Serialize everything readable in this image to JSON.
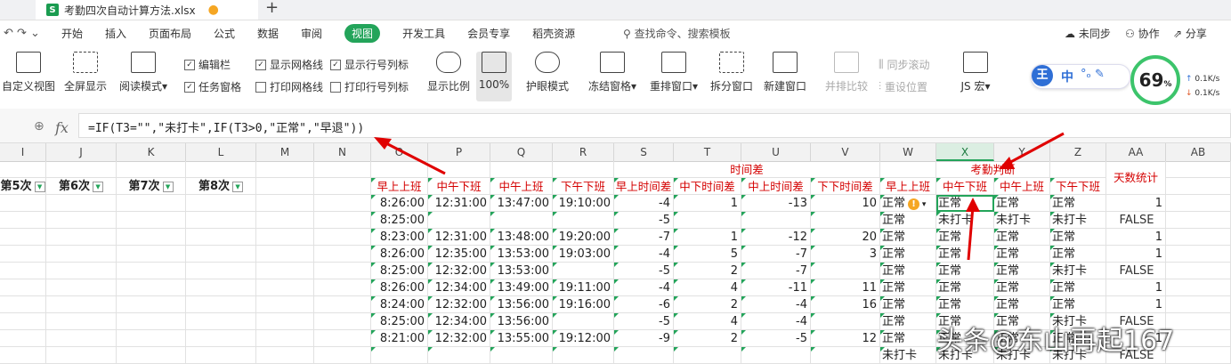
{
  "app": {
    "file_tab": "考勤四次自动计算方法.xlsx",
    "menus": [
      "开始",
      "插入",
      "页面布局",
      "公式",
      "数据",
      "审阅",
      "视图",
      "开发工具",
      "会员专享",
      "稻壳资源"
    ],
    "active_menu": "视图",
    "search": "查找命令、搜索模板",
    "right_menu": {
      "sync": "未同步",
      "collab": "协作",
      "share": "分享"
    }
  },
  "ribbon": {
    "buttons": [
      "自定义视图",
      "全屏显示",
      "阅读模式",
      "显示比例",
      "100%",
      "护眼模式",
      "冻结窗格",
      "重排窗口",
      "拆分窗口",
      "新建窗口",
      "并排比较",
      "JS 宏"
    ],
    "checks": [
      {
        "label": "编辑栏",
        "checked": true
      },
      {
        "label": "任务窗格",
        "checked": true
      },
      {
        "label": "显示网格线",
        "checked": true
      },
      {
        "label": "打印网格线",
        "checked": false
      },
      {
        "label": "显示行号列标",
        "checked": true
      },
      {
        "label": "打印行号列标",
        "checked": false
      }
    ],
    "sync_scroll": "同步滚动",
    "reset_pos": "重设位置",
    "ime": {
      "brand": "王",
      "mode": "中"
    },
    "gauge": {
      "value": "69",
      "unit": "%"
    },
    "speed_up": "0.1K/s",
    "speed_down": "0.1K/s"
  },
  "formula_bar": {
    "fx": "fx",
    "formula": "=IF(T3=\"\",\"未打卡\",IF(T3>0,\"正常\",\"早退\"))"
  },
  "columns": [
    "I",
    "J",
    "K",
    "L",
    "M",
    "N",
    "O",
    "P",
    "Q",
    "R",
    "S",
    "T",
    "U",
    "V",
    "W",
    "X",
    "Y",
    "Z",
    "AA",
    "AB"
  ],
  "selected_column": "X",
  "headers": {
    "top_group_time": "时间差",
    "top_group_judge": "考勤判断",
    "attendance_cols": [
      "第5次",
      "第6次",
      "第7次",
      "第8次"
    ],
    "row2": [
      "早上上班",
      "中午下班",
      "中午上班",
      "下午下班",
      "早上时间差",
      "中下时间差",
      "中上时间差",
      "下下时间差",
      "早上上班",
      "中午下班",
      "中午上班",
      "下午下班"
    ],
    "stat": "天数统计"
  },
  "rows": [
    {
      "O": "8:26:00",
      "P": "12:31:00",
      "Q": "13:47:00",
      "R": "19:10:00",
      "S": "-4",
      "T": "1",
      "U": "-13",
      "V": "10",
      "W": "正常",
      "X": "正常",
      "Y": "正常",
      "Z": "正常",
      "AA": "1"
    },
    {
      "O": "8:25:00",
      "P": "",
      "Q": "",
      "R": "",
      "S": "-5",
      "T": "",
      "U": "",
      "V": "",
      "W": "正常",
      "X": "未打卡",
      "Y": "未打卡",
      "Z": "未打卡",
      "AA": "FALSE"
    },
    {
      "O": "8:23:00",
      "P": "12:31:00",
      "Q": "13:48:00",
      "R": "19:20:00",
      "S": "-7",
      "T": "1",
      "U": "-12",
      "V": "20",
      "W": "正常",
      "X": "正常",
      "Y": "正常",
      "Z": "正常",
      "AA": "1"
    },
    {
      "O": "8:26:00",
      "P": "12:35:00",
      "Q": "13:53:00",
      "R": "19:03:00",
      "S": "-4",
      "T": "5",
      "U": "-7",
      "V": "3",
      "W": "正常",
      "X": "正常",
      "Y": "正常",
      "Z": "正常",
      "AA": "1"
    },
    {
      "O": "8:25:00",
      "P": "12:32:00",
      "Q": "13:53:00",
      "R": "",
      "S": "-5",
      "T": "2",
      "U": "-7",
      "V": "",
      "W": "正常",
      "X": "正常",
      "Y": "正常",
      "Z": "未打卡",
      "AA": "FALSE"
    },
    {
      "O": "8:26:00",
      "P": "12:34:00",
      "Q": "13:49:00",
      "R": "19:11:00",
      "S": "-4",
      "T": "4",
      "U": "-11",
      "V": "11",
      "W": "正常",
      "X": "正常",
      "Y": "正常",
      "Z": "正常",
      "AA": "1"
    },
    {
      "O": "8:24:00",
      "P": "12:32:00",
      "Q": "13:56:00",
      "R": "19:16:00",
      "S": "-6",
      "T": "2",
      "U": "-4",
      "V": "16",
      "W": "正常",
      "X": "正常",
      "Y": "正常",
      "Z": "正常",
      "AA": "1"
    },
    {
      "O": "8:25:00",
      "P": "12:34:00",
      "Q": "13:56:00",
      "R": "",
      "S": "-5",
      "T": "4",
      "U": "-4",
      "V": "",
      "W": "正常",
      "X": "正常",
      "Y": "正常",
      "Z": "未打卡",
      "AA": "FALSE"
    },
    {
      "O": "8:21:00",
      "P": "12:32:00",
      "Q": "13:55:00",
      "R": "19:12:00",
      "S": "-9",
      "T": "2",
      "U": "-5",
      "V": "12",
      "W": "正常",
      "X": "正常",
      "Y": "正常",
      "Z": "正常",
      "AA": "1"
    },
    {
      "O": "",
      "P": "",
      "Q": "",
      "R": "",
      "S": "",
      "T": "",
      "U": "",
      "V": "",
      "W": "未打卡",
      "X": "未打卡",
      "Y": "未打卡",
      "Z": "未打卡",
      "AA": "FALSE"
    }
  ],
  "watermark": "头条@东山再起167"
}
